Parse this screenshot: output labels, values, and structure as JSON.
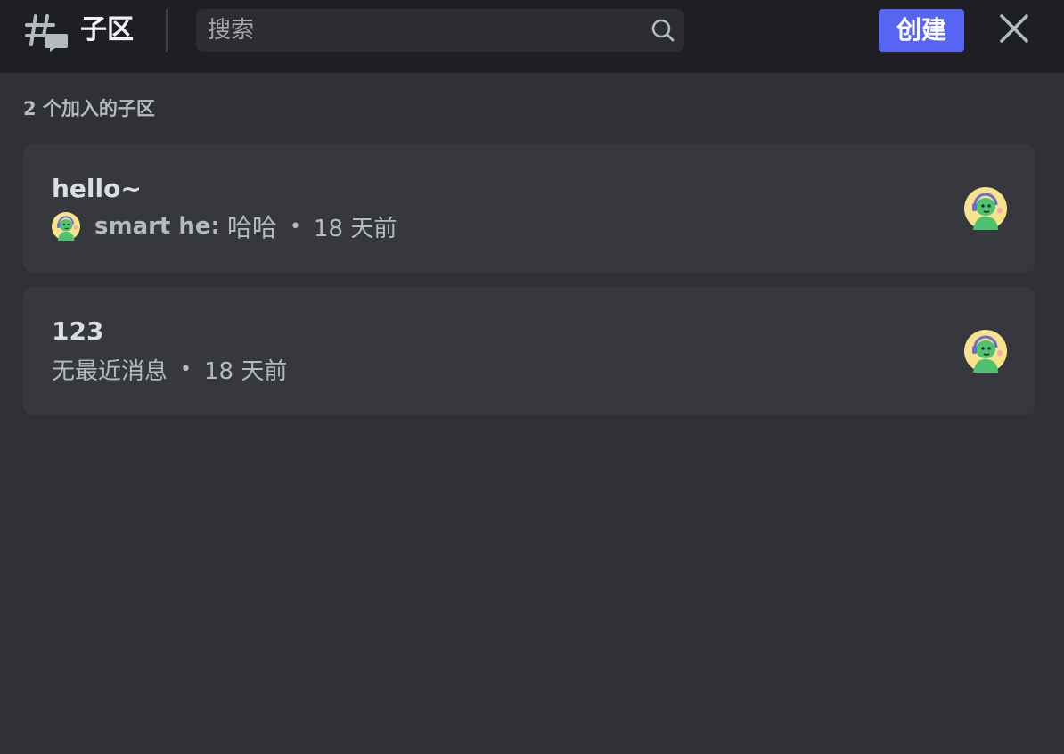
{
  "header": {
    "icon": "threads-icon",
    "title": "子区",
    "search": {
      "placeholder": "搜索",
      "icon": "search-icon"
    },
    "create_label": "创建",
    "close_icon": "close-icon"
  },
  "section": {
    "label": "2 个加入的子区"
  },
  "threads": [
    {
      "title": "hello~",
      "author": "smart he:",
      "preview": "哈哈",
      "separator": "•",
      "time": "18 天前"
    },
    {
      "title": "123",
      "preview": "无最近消息",
      "separator": "•",
      "time": "18 天前"
    }
  ],
  "colors": {
    "background": "#2f3136",
    "header": "#1e1f22",
    "card": "#36383e",
    "accent": "#5865f2",
    "avatar_bg": "#f8e38a",
    "avatar_figure": "#4fc26f"
  }
}
